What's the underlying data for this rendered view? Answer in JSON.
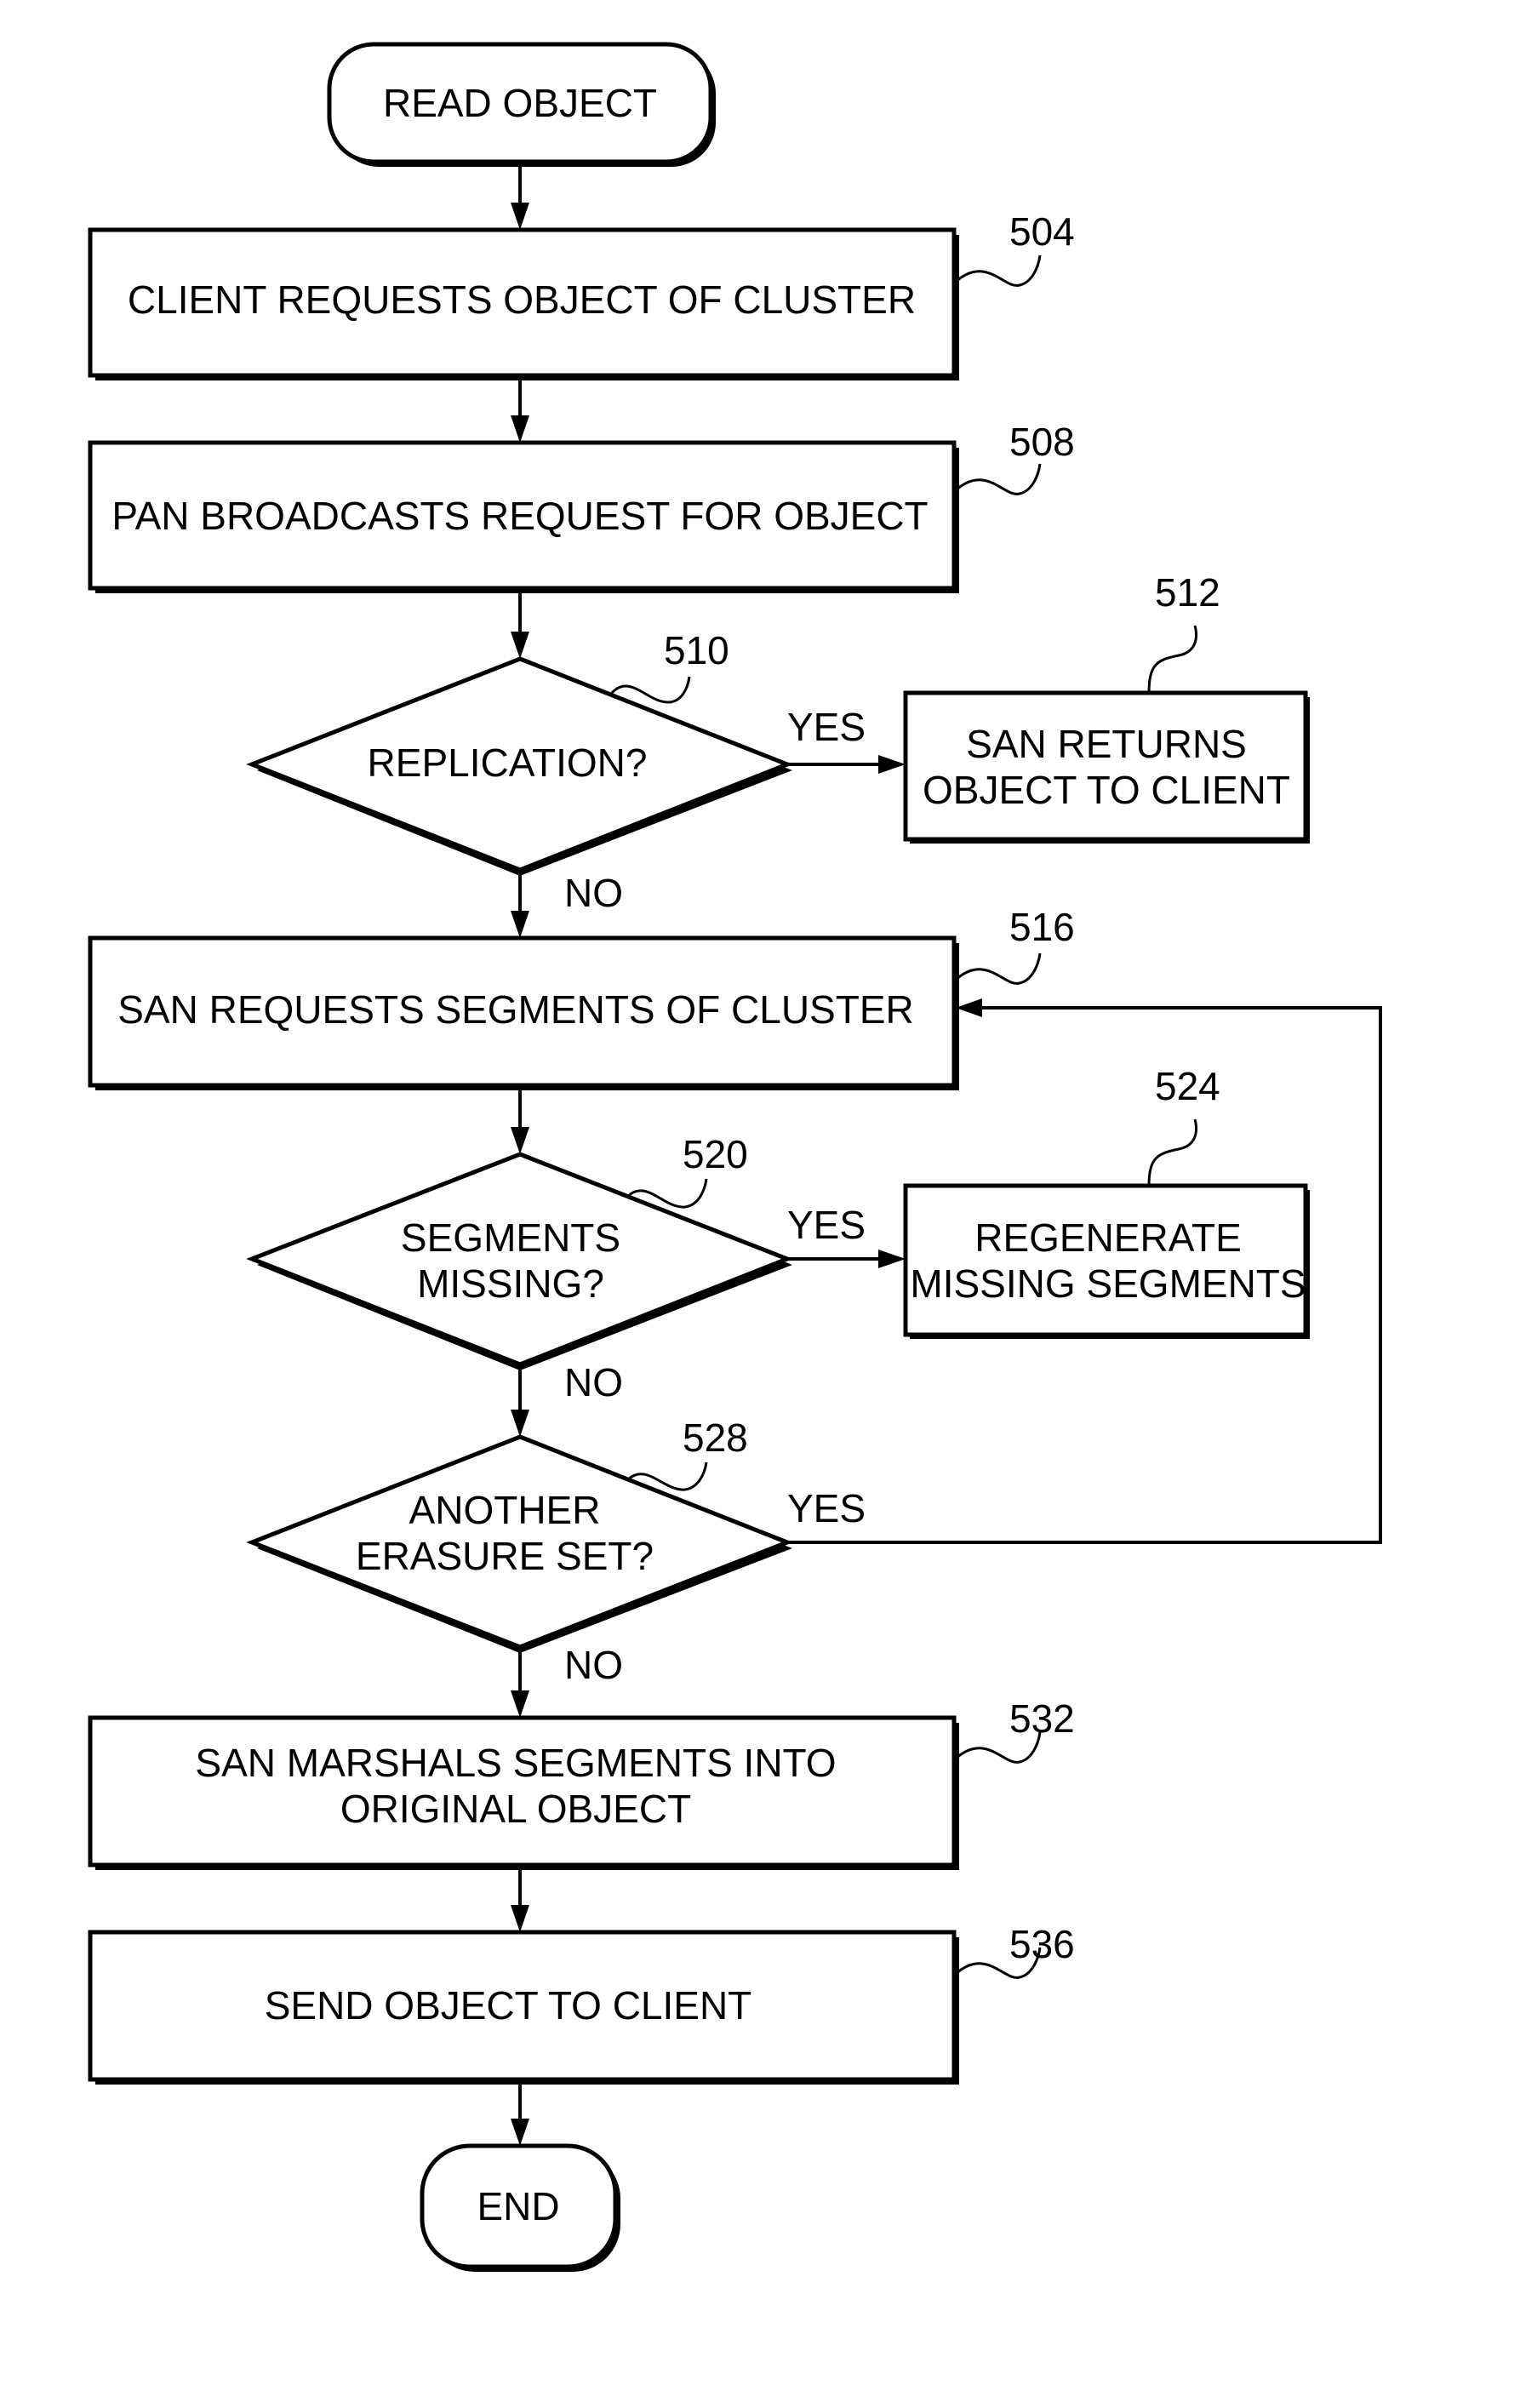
{
  "diagram": {
    "start": {
      "label": "READ OBJECT"
    },
    "end": {
      "label": "END"
    },
    "steps": [
      {
        "ref": "504",
        "lines": [
          "CLIENT REQUESTS OBJECT OF CLUSTER"
        ]
      },
      {
        "ref": "508",
        "lines": [
          "PAN BROADCASTS REQUEST FOR OBJECT"
        ]
      },
      {
        "ref": "510",
        "type": "decision",
        "lines": [
          "REPLICATION?"
        ],
        "yes": "YES",
        "no": "NO"
      },
      {
        "ref": "512",
        "lines": [
          "SAN RETURNS",
          "OBJECT TO CLIENT"
        ]
      },
      {
        "ref": "516",
        "lines": [
          "SAN REQUESTS SEGMENTS OF CLUSTER"
        ]
      },
      {
        "ref": "520",
        "type": "decision",
        "lines": [
          "SEGMENTS",
          "MISSING?"
        ],
        "yes": "YES",
        "no": "NO"
      },
      {
        "ref": "524",
        "lines": [
          "REGENERATE",
          "MISSING SEGMENTS"
        ]
      },
      {
        "ref": "528",
        "type": "decision",
        "lines": [
          "ANOTHER",
          "ERASURE SET?"
        ],
        "yes": "YES",
        "no": "NO"
      },
      {
        "ref": "532",
        "lines": [
          "SAN MARSHALS SEGMENTS INTO",
          "ORIGINAL OBJECT"
        ]
      },
      {
        "ref": "536",
        "lines": [
          "SEND OBJECT TO CLIENT"
        ]
      }
    ]
  }
}
